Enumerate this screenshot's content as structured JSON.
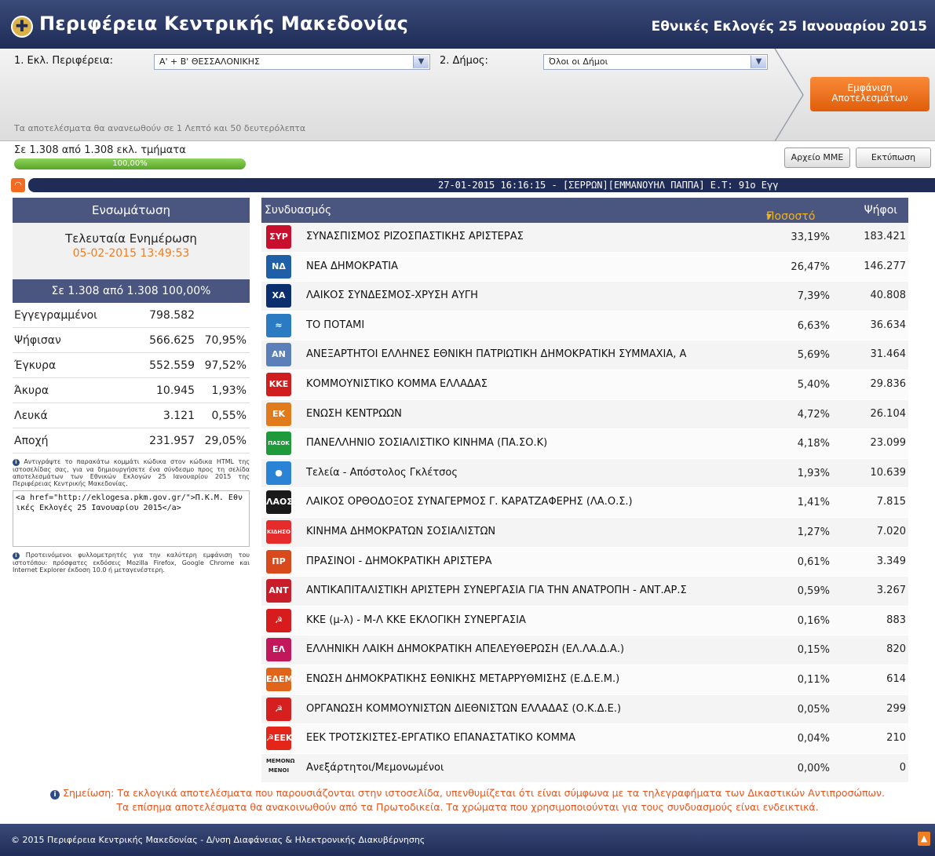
{
  "header": {
    "title": "Περιφέρεια Κεντρικής Μακεδονίας",
    "election": "Εθνικές Εκλογές 25 Ιανουαρίου 2015",
    "logo_symbol": "✚"
  },
  "filters": {
    "region_label": "1. Εκλ. Περιφέρεια:",
    "region_value": "Α' + Β' ΘΕΣΣΑΛΟΝΙΚΗΣ",
    "municipality_label": "2. Δήμος:",
    "municipality_value": "Όλοι οι Δήμοι",
    "show_results_label_1": "Εμφάνιση",
    "show_results_label_2": "Αποτελεσμάτων",
    "refresh_note": "Τα αποτελέσματα θα ανανεωθούν σε 1 Λεπτό και 50 δευτερόλεπτα"
  },
  "progress": {
    "label": "Σε 1.308 από 1.308 εκλ. τμήματα",
    "percent_text": "100,00%",
    "percent": 100
  },
  "toolbar": {
    "media_file": "Αρχείο ΜΜΕ",
    "print": "Εκτύπωση"
  },
  "ticker": {
    "rss_icon": "RSS",
    "text": "27-01-2015 16:16:15 - [ΣΕΡΡΩΝ][ΕΜΜΑΝΟΥΗΛ ΠΑΠΠΑ] Ε.Τ: 91ο Εγγ"
  },
  "summary": {
    "heading": "Ενσωμάτωση",
    "last_update_label": "Τελευταία Ενημέρωση",
    "last_update_value": "05-02-2015 13:49:53",
    "counted": "Σε 1.308 από 1.308 100,00%",
    "rows": [
      {
        "name": "Εγγεγραμμένοι",
        "value": "798.582",
        "pct": ""
      },
      {
        "name": "Ψήφισαν",
        "value": "566.625",
        "pct": "70,95%"
      },
      {
        "name": "Έγκυρα",
        "value": "552.559",
        "pct": "97,52%"
      },
      {
        "name": "Άκυρα",
        "value": "10.945",
        "pct": "1,93%"
      },
      {
        "name": "Λευκά",
        "value": "3.121",
        "pct": "0,55%"
      },
      {
        "name": "Αποχή",
        "value": "231.957",
        "pct": "29,05%"
      }
    ],
    "embed_note": "Αντιγράψτε το παρακάτω κομμάτι κώδικα στον κώδικα HTML της ιστοσελίδας σας, για να δημιουργήσετε ένα σύνδεσμο προς τη σελίδα αποτελεσμάτων των Εθνικών Εκλογών 25 Ιανουαρίου 2015 της Περιφέρειας Κεντρικής Μακεδονίας.",
    "embed_code": "<a href=\"http://eklogesa.pkm.gov.gr/\">Π.Κ.Μ. Εθνικές Εκλογές 25 Ιανουαρίου 2015</a>",
    "browser_note": "Προτεινόμενοι φυλλομετρητές για την καλύτερη εμφάνιση του ιστοτόπου: πρόσφατες εκδόσεις Mozilla Firefox, Google Chrome και Internet Explorer έκδοση 10.0 ή μεταγενέστερη."
  },
  "results": {
    "col_party": "Συνδυασμός",
    "col_pct": "Ποσοστό",
    "col_votes": "Ψήφοι",
    "rows": [
      {
        "logo": "ΣΥΡ",
        "color": "#c8102e",
        "name": "ΣΥΝΑΣΠΙΣΜΟΣ ΡΙΖΟΣΠΑΣΤΙΚΗΣ ΑΡΙΣΤΕΡΑΣ",
        "pct": "33,19%",
        "votes": "183.421"
      },
      {
        "logo": "ΝΔ",
        "color": "#1f5fa8",
        "name": "ΝΕΑ ΔΗΜΟΚΡΑΤΙΑ",
        "pct": "26,47%",
        "votes": "146.277"
      },
      {
        "logo": "ΧΑ",
        "color": "#0b2f6e",
        "name": "ΛΑΪΚΟΣ ΣΥΝΔΕΣΜΟΣ-ΧΡΥΣΗ ΑΥΓΗ",
        "pct": "7,39%",
        "votes": "40.808"
      },
      {
        "logo": "≈",
        "color": "#2a7bc1",
        "name": "ΤΟ ΠΟΤΑΜΙ",
        "pct": "6,63%",
        "votes": "36.634"
      },
      {
        "logo": "ΑΝ",
        "color": "#5b7fb8",
        "name": "ΑΝΕΞΑΡΤΗΤΟΙ ΕΛΛΗΝΕΣ ΕΘΝΙΚΗ ΠΑΤΡΙΩΤΙΚΗ ΔΗΜΟΚΡΑΤΙΚΗ ΣΥΜΜΑΧΙΑ, Α",
        "pct": "5,69%",
        "votes": "31.464"
      },
      {
        "logo": "KKE",
        "color": "#d01d1d",
        "name": "ΚΟΜΜΟΥΝΙΣΤΙΚΟ ΚΟΜΜΑ ΕΛΛΑΔΑΣ",
        "pct": "5,40%",
        "votes": "29.836"
      },
      {
        "logo": "ΕΚ",
        "color": "#e07a1a",
        "name": "ΕΝΩΣΗ ΚΕΝΤΡΩΩΝ",
        "pct": "4,72%",
        "votes": "26.104"
      },
      {
        "logo": "ΠΑΣΟΚ",
        "color": "#1f9a3a",
        "name": "ΠΑΝΕΛΛΗΝΙΟ ΣΟΣΙΑΛΙΣΤΙΚΟ ΚΙΝΗΜΑ (ΠΑ.ΣΟ.Κ)",
        "pct": "4,18%",
        "votes": "23.099"
      },
      {
        "logo": "●",
        "color": "#2b83d6",
        "name": "Τελεία - Απόστολος Γκλέτσος",
        "pct": "1,93%",
        "votes": "10.639"
      },
      {
        "logo": "ΛΑΟΣ",
        "color": "#1a1a1a",
        "name": "ΛΑΪΚΟΣ ΟΡΘΟΔΟΞΟΣ ΣΥΝΑΓΕΡΜΟΣ Γ. ΚΑΡΑΤΖΑΦΕΡΗΣ (ΛΑ.Ο.Σ.)",
        "pct": "1,41%",
        "votes": "7.815"
      },
      {
        "logo": "ΚΙΔΗΣΟ",
        "color": "#e52b2b",
        "name": "ΚΙΝΗΜΑ ΔΗΜΟΚΡΑΤΩΝ ΣΟΣΙΑΛΙΣΤΩΝ",
        "pct": "1,27%",
        "votes": "7.020"
      },
      {
        "logo": "ΠΡ",
        "color": "#d84a1b",
        "name": "ΠΡΑΣΙΝΟΙ - ΔΗΜΟΚΡΑΤΙΚΗ ΑΡΙΣΤΕΡΑ",
        "pct": "0,61%",
        "votes": "3.349"
      },
      {
        "logo": "ΑΝΤ",
        "color": "#c91d2c",
        "name": "ΑΝΤΙΚΑΠΙΤΑΛΙΣΤΙΚΗ ΑΡΙΣΤΕΡΗ ΣΥΝΕΡΓΑΣΙΑ ΓΙΑ ΤΗΝ ΑΝΑΤΡΟΠΗ - ΑΝΤ.ΑΡ.Σ",
        "pct": "0,59%",
        "votes": "3.267"
      },
      {
        "logo": "☭",
        "color": "#d61c1c",
        "name": "ΚΚΕ (μ-λ) - Μ-Λ ΚΚΕ ΕΚΛΟΓΙΚΗ ΣΥΝΕΡΓΑΣΙΑ",
        "pct": "0,16%",
        "votes": "883"
      },
      {
        "logo": "ΕΛ",
        "color": "#c2185b",
        "name": "ΕΛΛΗΝΙΚΗ ΛΑΪΚΗ ΔΗΜΟΚΡΑΤΙΚΗ ΑΠΕΛΕΥΘΕΡΩΣΗ (ΕΛ.ΛΑ.Δ.Α.)",
        "pct": "0,15%",
        "votes": "820"
      },
      {
        "logo": "ΕΔΕΜ",
        "color": "#e0641a",
        "name": "ΕΝΩΣΗ ΔΗΜΟΚΡΑΤΙΚΗΣ ΕΘΝΙΚΗΣ ΜΕΤΑΡΡΥΘΜΙΣΗΣ (Ε.Δ.Ε.Μ.)",
        "pct": "0,11%",
        "votes": "614"
      },
      {
        "logo": "☭",
        "color": "#d62020",
        "name": "ΟΡΓΑΝΩΣΗ ΚΟΜΜΟΥΝΙΣΤΩΝ ΔΙΕΘΝΙΣΤΩΝ ΕΛΛΑΔΑΣ (Ο.Κ.Δ.Ε.)",
        "pct": "0,05%",
        "votes": "299"
      },
      {
        "logo": "☭ΕΕΚ",
        "color": "#e4261a",
        "name": "ΕΕΚ ΤΡΟΤΣΚΙΣΤΕΣ-ΕΡΓΑΤΙΚΟ ΕΠΑΝΑΣΤΑΤΙΚΟ ΚΟΜΜΑ",
        "pct": "0,04%",
        "votes": "210"
      },
      {
        "logo": "ΜΕΜΟΝΩ ΜΕΝΟΙ",
        "color": "#f4f4f4",
        "name": "Ανεξάρτητοι/Μεμονωμένοι",
        "pct": "0,00%",
        "votes": "0"
      }
    ]
  },
  "footer": {
    "note_line1": "Σημείωση: Τα εκλογικά αποτελέσματα που παρουσιάζονται στην ιστοσελίδα, υπενθυμίζεται ότι είναι σύμφωνα με τα τηλεγραφήματα των Δικαστικών Αντιπροσώπων.",
    "note_line2": "Τα επίσημα αποτελέσματα θα ανακοινωθούν από τα Πρωτοδικεία. Τα χρώματα που χρησιμοποιούνται για τους συνδυασμούς είναι ενδεικτικά.",
    "copyright": "© 2015 Περιφέρεια Κεντρικής Μακεδονίας - Δ/νση Διαφάνειας & Ηλεκτρονικής Διακυβέρνησης"
  }
}
